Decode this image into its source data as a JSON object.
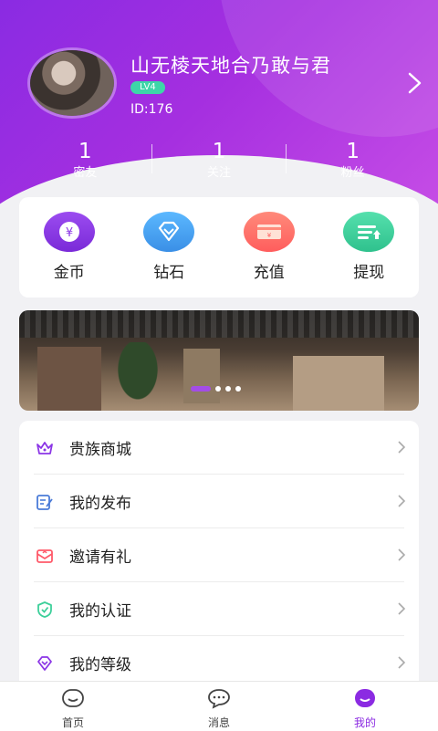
{
  "profile": {
    "name": "山无棱天地合乃敢与君",
    "level": "LV4",
    "id_text": "ID:176"
  },
  "stats": [
    {
      "value": "1",
      "label": "密友"
    },
    {
      "value": "1",
      "label": "关注"
    },
    {
      "value": "1",
      "label": "粉丝"
    }
  ],
  "actions": [
    {
      "label": "金币",
      "icon": "gold-coin-icon",
      "color": "#8b35e6"
    },
    {
      "label": "钻石",
      "icon": "diamond-icon",
      "color": "#4aa8f0"
    },
    {
      "label": "充值",
      "icon": "recharge-card-icon",
      "color": "#ff6b6b"
    },
    {
      "label": "提现",
      "icon": "withdraw-icon",
      "color": "#3ccf9a"
    }
  ],
  "banner": {
    "slides_count": 4,
    "active_index": 0
  },
  "menu": [
    {
      "label": "贵族商城",
      "icon": "crown-icon",
      "color": "#8b35e6"
    },
    {
      "label": "我的发布",
      "icon": "edit-icon",
      "color": "#4a7bd8"
    },
    {
      "label": "邀请有礼",
      "icon": "envelope-icon",
      "color": "#ff5a6a"
    },
    {
      "label": "我的认证",
      "icon": "shield-check-icon",
      "color": "#3ccf9a"
    },
    {
      "label": "我的等级",
      "icon": "level-diamond-icon",
      "color": "#8b35e6"
    }
  ],
  "tabs": [
    {
      "label": "首页",
      "icon": "home-face-icon",
      "active": false
    },
    {
      "label": "消息",
      "icon": "chat-bubble-icon",
      "active": false
    },
    {
      "label": "我的",
      "icon": "profile-smile-icon",
      "active": true
    }
  ],
  "colors": {
    "brand": "#8b2be2",
    "level_badge": "#3dd6a8"
  }
}
